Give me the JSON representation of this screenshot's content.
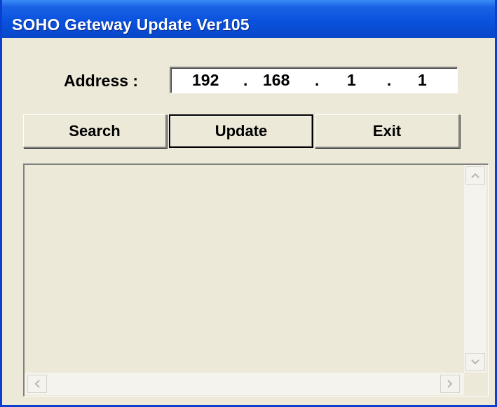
{
  "window": {
    "title": "SOHO Geteway Update Ver105"
  },
  "address": {
    "label": "Address :",
    "octets": [
      "192",
      "168",
      "1",
      "1"
    ],
    "separator": "."
  },
  "buttons": {
    "search": "Search",
    "update": "Update",
    "exit": "Exit"
  },
  "log": {
    "content": ""
  },
  "icons": {
    "scroll_up": "chevron-up-icon",
    "scroll_down": "chevron-down-icon",
    "scroll_left": "chevron-left-icon",
    "scroll_right": "chevron-right-icon"
  },
  "colors": {
    "titlebar": "#0a52dd",
    "window_bg": "#ece9d8"
  }
}
